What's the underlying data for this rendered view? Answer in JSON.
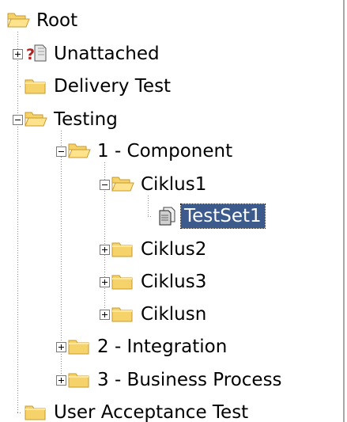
{
  "tree": {
    "nodes": [
      {
        "label": "Root",
        "icon": "folder-open-icon",
        "expander": "none",
        "level": 0
      },
      {
        "label": "Unattached",
        "icon": "unknown-document-icon",
        "expander": "plus",
        "level": 1
      },
      {
        "label": "Delivery Test",
        "icon": "folder-icon",
        "expander": "none",
        "level": 1
      },
      {
        "label": "Testing",
        "icon": "folder-open-icon",
        "expander": "minus",
        "level": 1
      },
      {
        "label": "1 - Component",
        "icon": "folder-open-icon",
        "expander": "minus",
        "level": 2
      },
      {
        "label": "Ciklus1",
        "icon": "folder-open-icon",
        "expander": "minus",
        "level": 3
      },
      {
        "label": "TestSet1",
        "icon": "test-set-icon",
        "expander": "none",
        "level": 4,
        "selected": true
      },
      {
        "label": "Ciklus2",
        "icon": "folder-icon",
        "expander": "plus",
        "level": 3
      },
      {
        "label": "Ciklus3",
        "icon": "folder-icon",
        "expander": "plus",
        "level": 3
      },
      {
        "label": "Ciklusn",
        "icon": "folder-icon",
        "expander": "plus",
        "level": 3
      },
      {
        "label": "2 - Integration",
        "icon": "folder-icon",
        "expander": "plus",
        "level": 2
      },
      {
        "label": "3 - Business Process",
        "icon": "folder-icon",
        "expander": "plus",
        "level": 2
      },
      {
        "label": "User Acceptance Test",
        "icon": "folder-icon",
        "expander": "none",
        "level": 1
      }
    ]
  },
  "colors": {
    "folder_fill": "#f5d36a",
    "folder_edge": "#c99a2e",
    "selection_bg": "#3c5a8c",
    "connector": "#8a8a8a"
  }
}
